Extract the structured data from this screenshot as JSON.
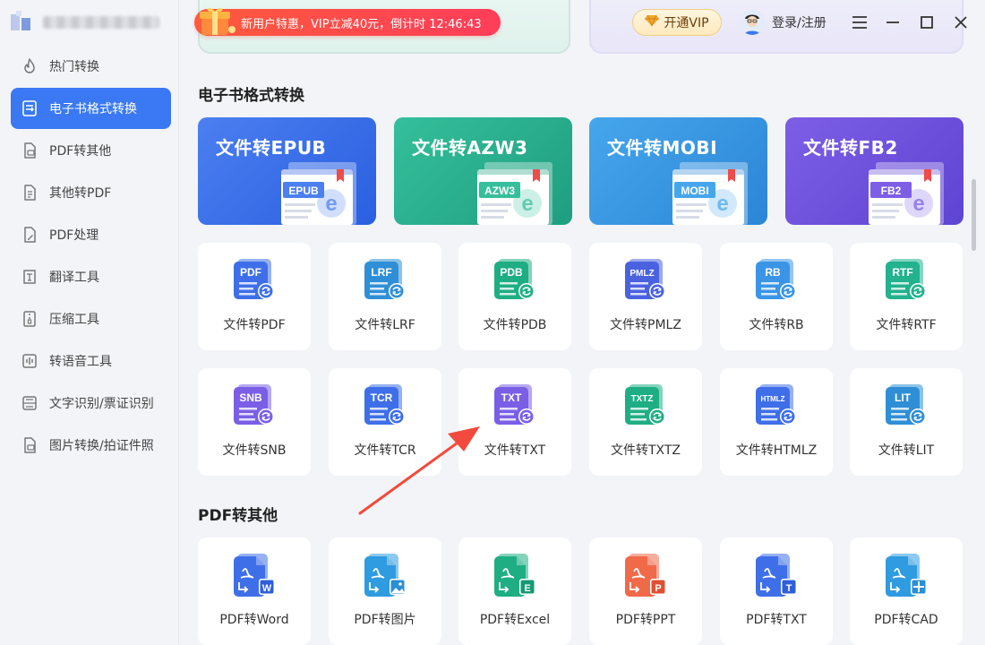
{
  "promo": {
    "text": "新用户特惠，VIP立减40元，倒计时 12:46:43"
  },
  "vip_button": "开通VIP",
  "login": "登录/注册",
  "sidebar": {
    "items": [
      {
        "label": "热门转换",
        "icon": "fire-icon"
      },
      {
        "label": "电子书格式转换",
        "icon": "ebook-convert-icon",
        "active": true
      },
      {
        "label": "PDF转其他",
        "icon": "pdf-doc-icon"
      },
      {
        "label": "其他转PDF",
        "icon": "doc-to-pdf-icon"
      },
      {
        "label": "PDF处理",
        "icon": "pdf-edit-icon"
      },
      {
        "label": "翻译工具",
        "icon": "translate-icon"
      },
      {
        "label": "压缩工具",
        "icon": "compress-icon"
      },
      {
        "label": "转语音工具",
        "icon": "voice-icon"
      },
      {
        "label": "文字识别/票证识别",
        "icon": "ocr-icon"
      },
      {
        "label": "图片转换/拍证件照",
        "icon": "image-icon"
      }
    ]
  },
  "sections": {
    "ebook": {
      "title": "电子书格式转换",
      "featured": [
        {
          "title": "文件转EPUB",
          "badge": "EPUB",
          "color1": "#4c7ff0",
          "color2": "#2a5fe0"
        },
        {
          "title": "文件转AZW3",
          "badge": "AZW3",
          "color1": "#35bf9b",
          "color2": "#1f9e80"
        },
        {
          "title": "文件转MOBI",
          "badge": "MOBI",
          "color1": "#46a6ec",
          "color2": "#2b86d6"
        },
        {
          "title": "文件转FB2",
          "badge": "FB2",
          "color1": "#7d5fe6",
          "color2": "#5e44d2"
        }
      ],
      "tools": [
        {
          "label": "文件转PDF",
          "tag": "PDF",
          "color": "#3f6fe8"
        },
        {
          "label": "文件转LRF",
          "tag": "LRF",
          "color": "#2f8fd6"
        },
        {
          "label": "文件转PDB",
          "tag": "PDB",
          "color": "#1fae84"
        },
        {
          "label": "文件转PMLZ",
          "tag": "PMLZ",
          "color": "#4a62e0"
        },
        {
          "label": "文件转RB",
          "tag": "RB",
          "color": "#3b95e6"
        },
        {
          "label": "文件转RTF",
          "tag": "RTF",
          "color": "#22b28e"
        },
        {
          "label": "文件转SNB",
          "tag": "SNB",
          "color": "#7a5fe6"
        },
        {
          "label": "文件转TCR",
          "tag": "TCR",
          "color": "#3f6fe8"
        },
        {
          "label": "文件转TXT",
          "tag": "TXT",
          "color": "#7a5fe6"
        },
        {
          "label": "文件转TXTZ",
          "tag": "TXTZ",
          "color": "#1fae84"
        },
        {
          "label": "文件转HTMLZ",
          "tag": "HTMLZ",
          "color": "#3f6fe8"
        },
        {
          "label": "文件转LIT",
          "tag": "LIT",
          "color": "#2f8fd6"
        }
      ]
    },
    "pdf_other": {
      "title": "PDF转其他",
      "tools": [
        {
          "label": "PDF转Word",
          "badge": "W",
          "color": "#3f6fe8",
          "badge_color": "#2f5ed8"
        },
        {
          "label": "PDF转图片",
          "badge": "img",
          "color": "#2f9be0",
          "badge_color": "#2a8fd4"
        },
        {
          "label": "PDF转Excel",
          "badge": "E",
          "color": "#1fae84",
          "badge_color": "#169a74"
        },
        {
          "label": "PDF转PPT",
          "badge": "P",
          "color": "#f06a4a",
          "badge_color": "#e04f33"
        },
        {
          "label": "PDF转TXT",
          "badge": "T",
          "color": "#3f6fe8",
          "badge_color": "#2f5ed8"
        },
        {
          "label": "PDF转CAD",
          "badge": "cad",
          "color": "#2f9be0",
          "badge_color": "#2a8fd4"
        }
      ]
    }
  }
}
